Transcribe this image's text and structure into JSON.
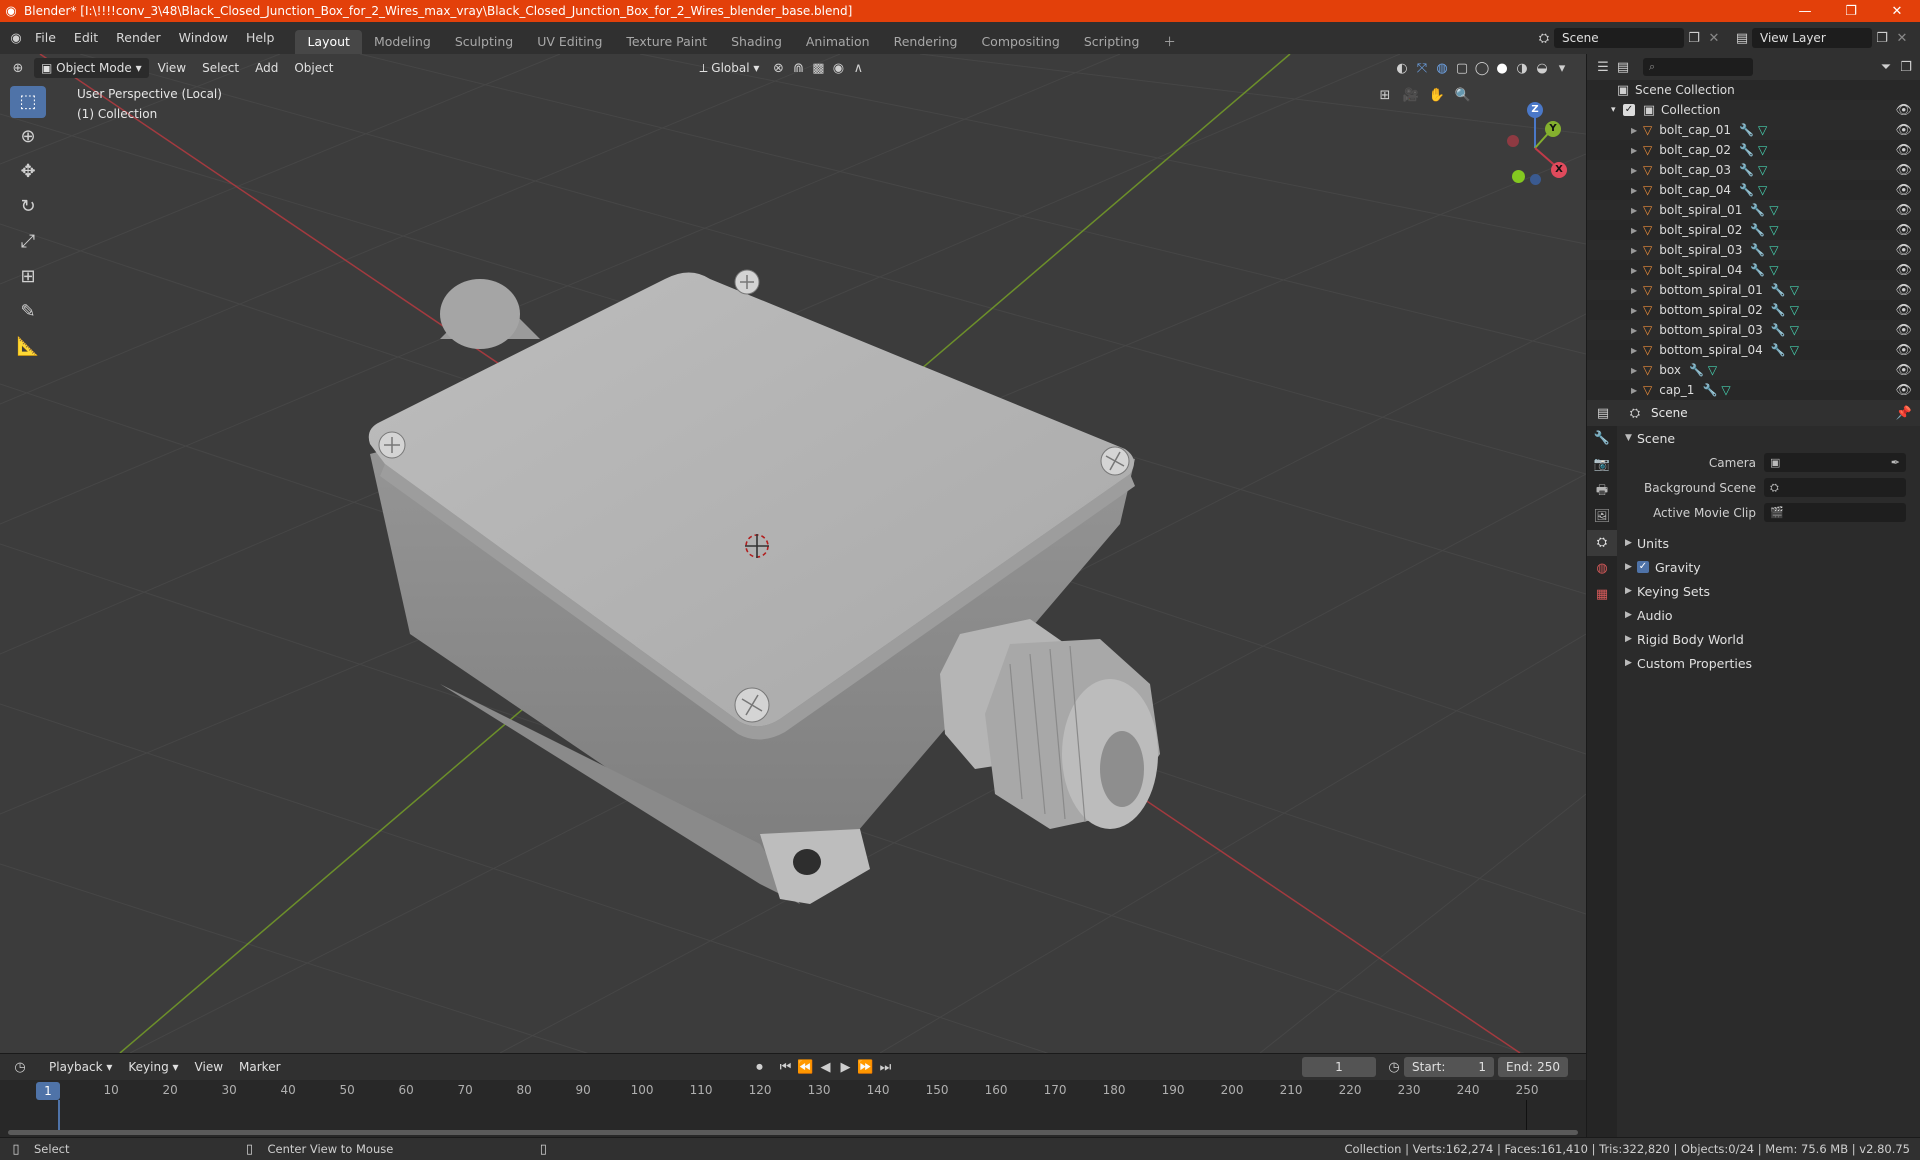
{
  "window": {
    "title": "Blender* [I:\\!!!!conv_3\\48\\Black_Closed_Junction_Box_for_2_Wires_max_vray\\Black_Closed_Junction_Box_for_2_Wires_blender_base.blend]"
  },
  "menu": [
    "File",
    "Edit",
    "Render",
    "Window",
    "Help"
  ],
  "workspaces": [
    "Layout",
    "Modeling",
    "Sculpting",
    "UV Editing",
    "Texture Paint",
    "Shading",
    "Animation",
    "Rendering",
    "Compositing",
    "Scripting"
  ],
  "active_workspace": "Layout",
  "scene_field": "Scene",
  "view_layer_field": "View Layer",
  "viewport": {
    "mode": "Object Mode",
    "menus": [
      "View",
      "Select",
      "Add",
      "Object"
    ],
    "transform_orientation": "Global",
    "overlay_line1": "User Perspective (Local)",
    "overlay_line2": "(1) Collection",
    "gizmo": {
      "x": "X",
      "y": "Y",
      "z": "Z"
    }
  },
  "outliner": {
    "root": "Scene Collection",
    "collection": "Collection",
    "objects": [
      "bolt_cap_01",
      "bolt_cap_02",
      "bolt_cap_03",
      "bolt_cap_04",
      "bolt_spiral_01",
      "bolt_spiral_02",
      "bolt_spiral_03",
      "bolt_spiral_04",
      "bottom_spiral_01",
      "bottom_spiral_02",
      "bottom_spiral_03",
      "bottom_spiral_04",
      "box",
      "cap_1"
    ]
  },
  "properties": {
    "header": "Scene",
    "panel": "Scene",
    "fields": {
      "camera": "Camera",
      "background_scene": "Background Scene",
      "active_movie_clip": "Active Movie Clip"
    },
    "sections": [
      "Units",
      "Gravity",
      "Keying Sets",
      "Audio",
      "Rigid Body World",
      "Custom Properties"
    ]
  },
  "timeline": {
    "menus": [
      "Playback",
      "Keying",
      "View",
      "Marker"
    ],
    "current_frame": "1",
    "start_label": "Start:",
    "start": "1",
    "end_label": "End:",
    "end": "250",
    "ticks": [
      "10",
      "20",
      "30",
      "40",
      "50",
      "60",
      "70",
      "80",
      "90",
      "100",
      "110",
      "120",
      "130",
      "140",
      "150",
      "160",
      "170",
      "180",
      "190",
      "200",
      "210",
      "220",
      "230",
      "240",
      "250"
    ]
  },
  "status": {
    "left": "Select",
    "middle": "Center View to Mouse",
    "right": "Collection | Verts:162,274 | Faces:161,410 | Tris:322,820 | Objects:0/24 | Mem: 75.6 MB | v2.80.75"
  }
}
